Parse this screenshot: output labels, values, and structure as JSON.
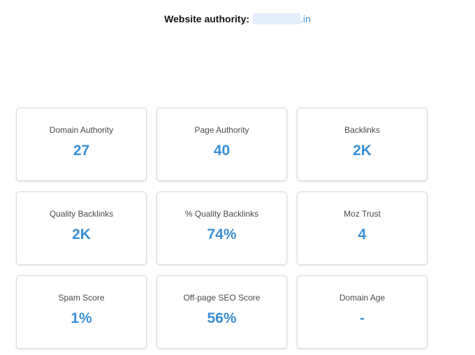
{
  "header": {
    "label": "Website authority:",
    "domain_suffix": ".in"
  },
  "metrics": [
    {
      "title": "Domain Authority",
      "value": "27"
    },
    {
      "title": "Page Authority",
      "value": "40"
    },
    {
      "title": "Backlinks",
      "value": "2K"
    },
    {
      "title": "Quality Backlinks",
      "value": "2K"
    },
    {
      "title": "% Quality Backlinks",
      "value": "74%"
    },
    {
      "title": "Moz Trust",
      "value": "4"
    },
    {
      "title": "Spam Score",
      "value": "1%"
    },
    {
      "title": "Off-page SEO Score",
      "value": "56%"
    },
    {
      "title": "Domain Age",
      "value": "-"
    }
  ]
}
